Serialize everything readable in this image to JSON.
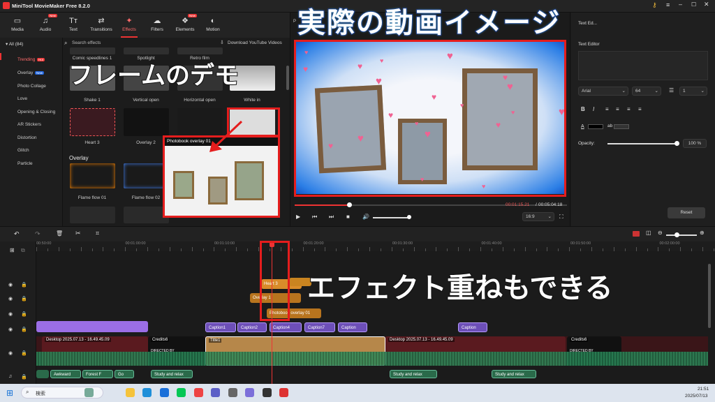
{
  "app": {
    "title": "MiniTool MovieMaker Free 8.2.0"
  },
  "toolbar": [
    {
      "label": "Media",
      "icon": "media-icon"
    },
    {
      "label": "Audio",
      "icon": "audio-icon",
      "badge": "New"
    },
    {
      "label": "Text",
      "icon": "text-icon"
    },
    {
      "label": "Transitions",
      "icon": "transitions-icon"
    },
    {
      "label": "Effects",
      "icon": "effects-icon",
      "active": true
    },
    {
      "label": "Filters",
      "icon": "filters-icon"
    },
    {
      "label": "Elements",
      "icon": "elements-icon",
      "badge": "New"
    },
    {
      "label": "Motion",
      "icon": "motion-icon"
    }
  ],
  "sidebar": {
    "all": "All (84)",
    "items": [
      "Trending",
      "Overlay",
      "Photo Collage",
      "Love",
      "Opening & Closing",
      "AR Stickers",
      "Distortion",
      "Glitch",
      "Particle"
    ],
    "badges": {
      "Trending": "Hot",
      "Overlay": "New"
    }
  },
  "effects": {
    "search_placeholder": "Search effects",
    "download_label": "Download YouTube Videos",
    "row0": [
      "Comic speedlines 1",
      "Spotlight",
      "Retro film"
    ],
    "row1": [
      "Shake 1",
      "Vertical open",
      "Horizontal open",
      "White in"
    ],
    "row2": [
      "Heart 3",
      "Overlay 2",
      "",
      "Photobook overlay 01"
    ],
    "section": "Overlay",
    "row3": [
      "Flame flow 01",
      "Flame flow 02"
    ],
    "popup_title": "Photobook overlay 01"
  },
  "player": {
    "current_time": "00:01:15.21",
    "total_time": "00:05:04:18",
    "aspect": "16:9",
    "progress": 0.2
  },
  "props": {
    "tab": "Text Ed...",
    "editor_title": "Text Editor",
    "font": "Arial",
    "size": "64",
    "spacing": "1",
    "opacity_label": "Opacity:",
    "opacity_value": "100 %",
    "opacity": 1.0,
    "reset": "Reset",
    "text_color": "#000000"
  },
  "timeline": {
    "ruler": [
      "00:50:00",
      "00:01:00:00",
      "00:01:10:00",
      "00:01:20:00",
      "00:01:30:00",
      "00:01:40:00",
      "00:01:50:00",
      "00:02:00:00"
    ],
    "fx": [
      "Heart 3",
      "Overlay 1",
      "Photobook overlay 01"
    ],
    "captions": [
      "Caption1",
      "Caption2",
      "Caption4",
      "Caption7",
      "Caption",
      "Caption"
    ],
    "video": [
      "Desktop 2025.07.13 - 16.49.45.09",
      "Credits6",
      "Title1",
      "Desktop 2025.07.13 - 16.49.45.09",
      "Credits6"
    ],
    "credits_text": "DIRECTED BY",
    "music": [
      "Awkward",
      "Forest F",
      "Go",
      "Study and relax",
      "Study and relax",
      "Study and relax"
    ]
  },
  "overlays": {
    "top": "実際の動画イメージ",
    "left": "フレームのデモ",
    "right": "エフェクト重ねもできる"
  },
  "taskbar": {
    "search": "検索",
    "time": "21:51",
    "date": "2025/07/13"
  }
}
